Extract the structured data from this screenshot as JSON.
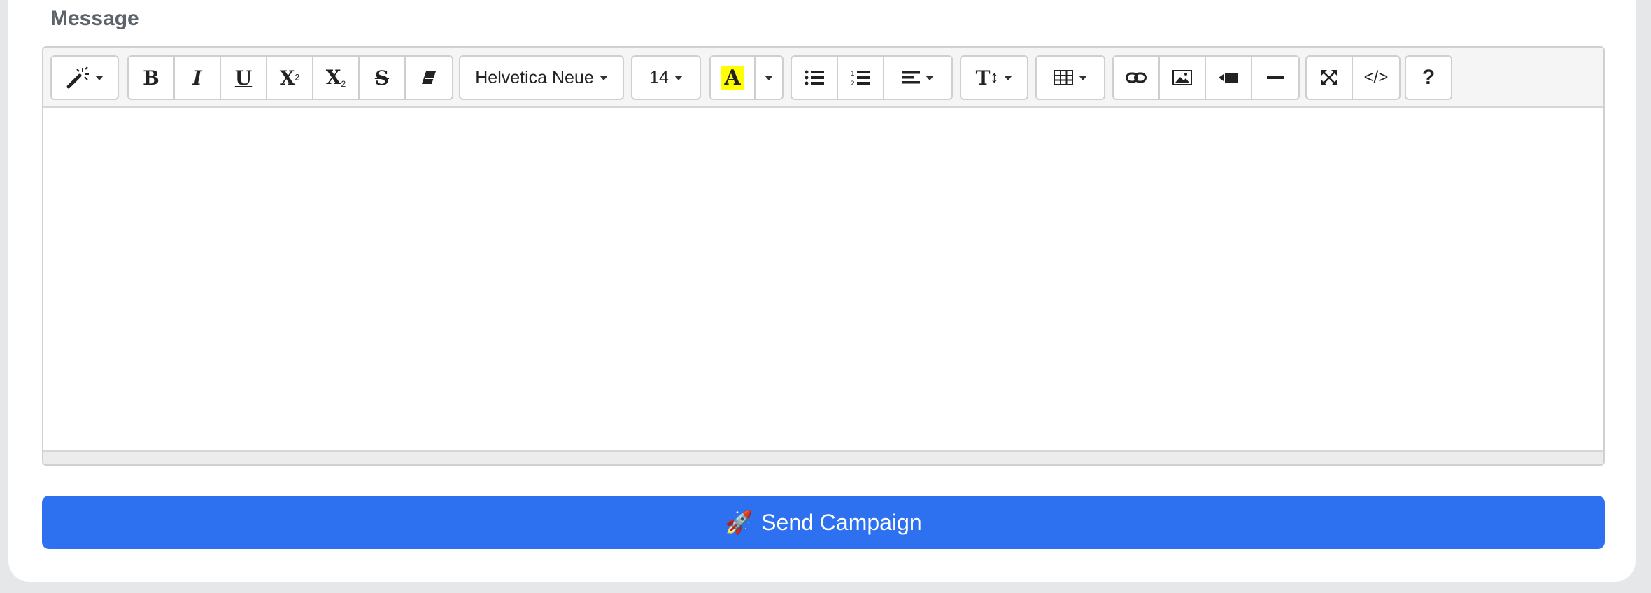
{
  "form": {
    "message_label": "Message",
    "send_button": {
      "icon": "rocket-icon",
      "emoji": "🚀",
      "label": "Send Campaign",
      "color": "#2d70f0"
    }
  },
  "toolbar": {
    "style_icon": "magic-wand-icon",
    "font_style_buttons": [
      "bold-icon",
      "italic-icon",
      "underline-icon",
      "superscript-icon",
      "subscript-icon",
      "strikethrough-icon",
      "eraser-icon"
    ],
    "font_family": "Helvetica Neue",
    "font_size": "14",
    "highlight_color": "#ffff00",
    "highlight_letter": "A",
    "list_buttons": [
      "unordered-list-icon",
      "ordered-list-icon",
      "align-icon"
    ],
    "line_height_icon": "line-height-icon",
    "table_icon": "table-icon",
    "insert_buttons": [
      "link-icon",
      "picture-icon",
      "video-icon",
      "horizontal-rule-icon"
    ],
    "view_buttons": [
      "fullscreen-icon",
      "code-view-icon"
    ],
    "help_icon": "help-icon",
    "help_label": "?",
    "code_label": "</>"
  }
}
